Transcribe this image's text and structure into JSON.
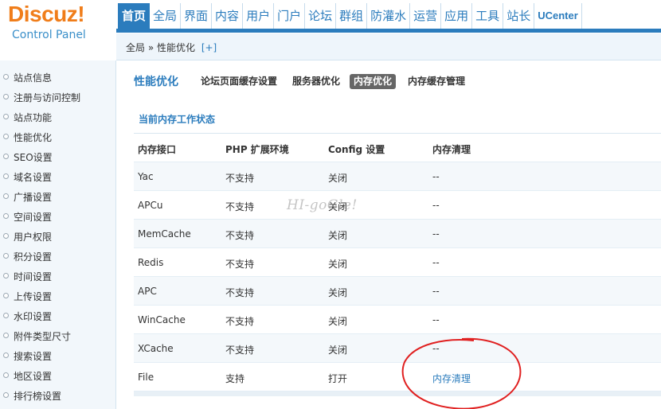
{
  "logo": {
    "brand": "Discuz!",
    "subtitle": "Control Panel"
  },
  "topnav": {
    "tabs": [
      "首页",
      "全局",
      "界面",
      "内容",
      "用户",
      "门户",
      "论坛",
      "群组",
      "防灌水",
      "运营",
      "应用",
      "工具",
      "站长",
      "UCenter"
    ],
    "active_index": 0
  },
  "breadcrumb": {
    "text": "全局 » 性能优化",
    "plus": "[+]"
  },
  "sidebar": {
    "items": [
      "站点信息",
      "注册与访问控制",
      "站点功能",
      "性能优化",
      "SEO设置",
      "域名设置",
      "广播设置",
      "空间设置",
      "用户权限",
      "积分设置",
      "时间设置",
      "上传设置",
      "水印设置",
      "附件类型尺寸",
      "搜索设置",
      "地区设置",
      "排行榜设置"
    ]
  },
  "subnav": {
    "title": "性能优化",
    "tabs": [
      "论坛页面缓存设置",
      "服务器优化",
      "内存优化",
      "内存缓存管理"
    ],
    "active_index": 2
  },
  "table": {
    "section_title": "当前内存工作状态",
    "headers": [
      "内存接口",
      "PHP 扩展环境",
      "Config 设置",
      "内存清理"
    ],
    "rows": [
      [
        "Yac",
        "不支持",
        "关闭",
        "--"
      ],
      [
        "APCu",
        "不支持",
        "关闭",
        "--"
      ],
      [
        "MemCache",
        "不支持",
        "关闭",
        "--"
      ],
      [
        "Redis",
        "不支持",
        "关闭",
        "--"
      ],
      [
        "APC",
        "不支持",
        "关闭",
        "--"
      ],
      [
        "WinCache",
        "不支持",
        "关闭",
        "--"
      ],
      [
        "XCache",
        "不支持",
        "关闭",
        "--"
      ],
      [
        "File",
        "支持",
        "打开",
        "内存清理"
      ]
    ]
  },
  "watermark": "HI-goGle!",
  "colors": {
    "accent": "#2b7cbd",
    "logo_orange": "#f07d1a",
    "annotation_red": "#e02020"
  }
}
